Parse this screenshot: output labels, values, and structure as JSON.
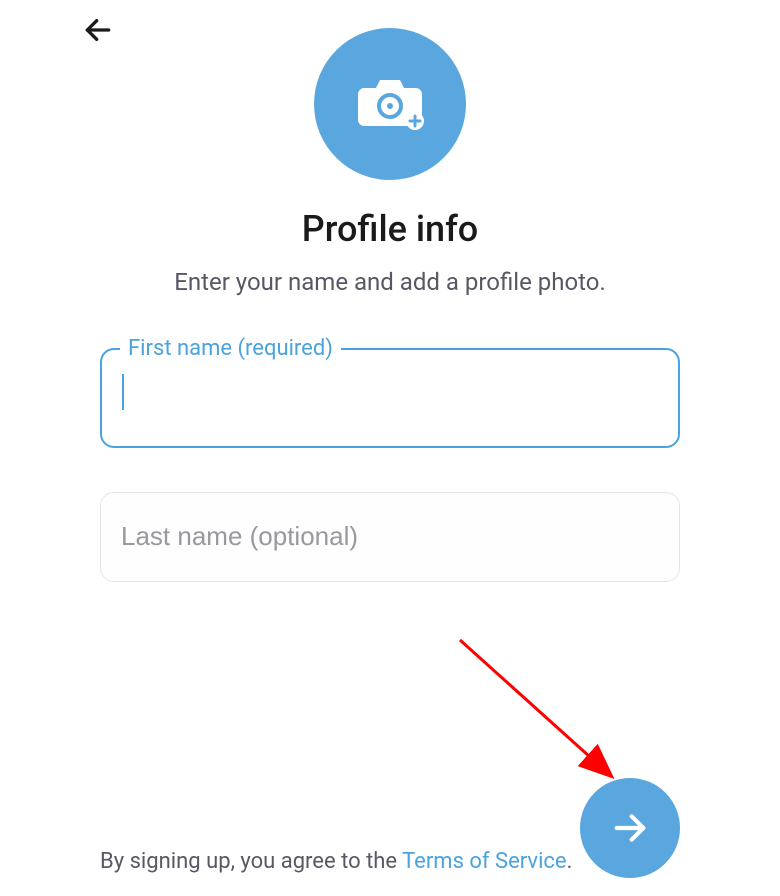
{
  "header": {
    "title": "Profile info",
    "subtitle": "Enter your name and add a profile photo."
  },
  "form": {
    "first_name": {
      "label": "First name (required)",
      "value": ""
    },
    "last_name": {
      "placeholder": "Last name (optional)",
      "value": ""
    }
  },
  "footer": {
    "terms_prefix": "By signing up, you agree to the ",
    "terms_link": "Terms of Service",
    "terms_suffix": "."
  },
  "colors": {
    "accent": "#5aa7e0",
    "focus_border": "#4aa3df"
  }
}
